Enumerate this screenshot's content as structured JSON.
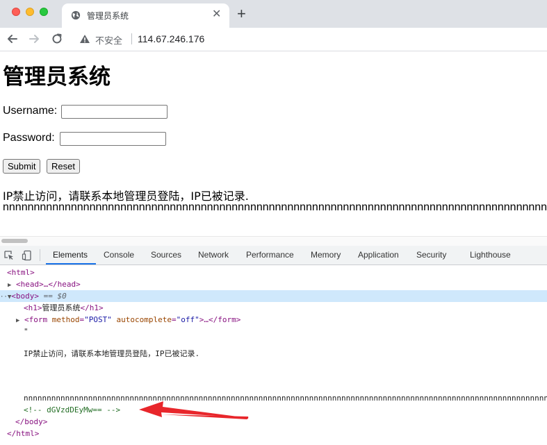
{
  "browser": {
    "tab_title": "管理员系统",
    "tab_close": "✕",
    "new_tab": "+",
    "security_label": "不安全",
    "url": "114.67.246.176"
  },
  "page": {
    "heading": "管理员系统",
    "username_label": "Username:",
    "username_value": "",
    "password_label": "Password:",
    "password_value": "",
    "submit_label": "Submit",
    "reset_label": "Reset",
    "message": "IP禁止访问，请联系本地管理员登陆，IP已被记录.",
    "n_line": "nnnnnnnnnnnnnnnnnnnnnnnnnnnnnnnnnnnnnnnnnnnnnnnnnnnnnnnnnnnnnnnnnnnnnnnnnnnnnnnnnnnnnnnnnnnnnnnnn"
  },
  "devtools": {
    "tabs": [
      "Elements",
      "Console",
      "Sources",
      "Network",
      "Performance",
      "Memory",
      "Application",
      "Security",
      "Lighthouse"
    ],
    "active_tab": "Elements",
    "dom": {
      "html_open": "<html>",
      "head": "<head>…</head>",
      "body_open": "<body>",
      "body_marker": "== $0",
      "h1_open": "<h1>",
      "h1_text": "管理员系统",
      "h1_close": "</h1>",
      "form_open": "<form",
      "form_attr1_name": "method",
      "form_attr1_value": "\"POST\"",
      "form_attr2_name": "autocomplete",
      "form_attr2_value": "\"off\"",
      "form_rest": ">…</form>",
      "quote_text": "\"",
      "msg_text": "IP禁止访问，请联系本地管理员登陆，IP已被记录.",
      "n_text": "nnnnnnnnnnnnnnnnnnnnnnnnnnnnnnnnnnnnnnnnnnnnnnnnnnnnnnnnnnnnnnnnnnnnnnnnnnnnnnnnnnnnnnnnnnnnnnnnnnnnnnnnnnnnnnnnnnn",
      "comment": "<!-- dGVzdDEyMw== -->",
      "body_close": "</body>",
      "html_close": "</html>"
    }
  },
  "colors": {
    "annotation_arrow": "#e8262b",
    "active_tab_underline": "#1a73e8",
    "selected_row": "#cfe8fc"
  }
}
